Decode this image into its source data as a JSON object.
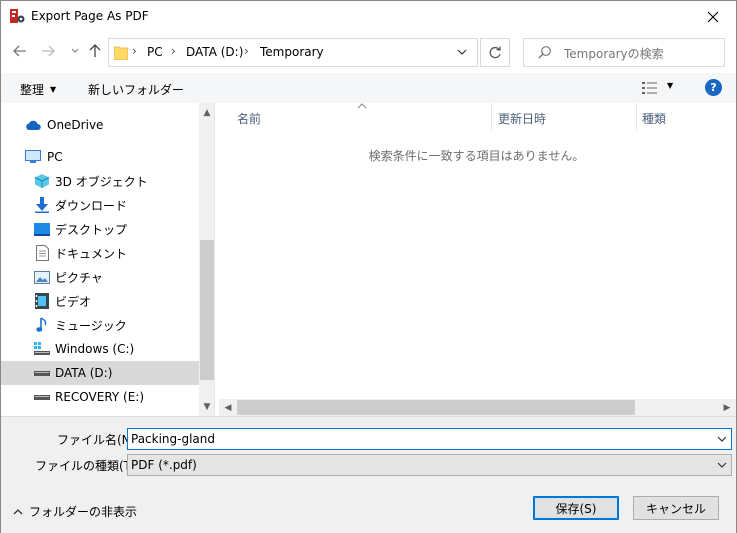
{
  "window": {
    "title": "Export Page As PDF"
  },
  "address": {
    "crumbs": [
      "PC",
      "DATA (D:)",
      "Temporary"
    ],
    "search_placeholder": "Temporaryの検索"
  },
  "toolbar": {
    "organize_label": "整理",
    "new_folder_label": "新しいフォルダー",
    "help_label": "?"
  },
  "nav": {
    "items": [
      {
        "label": "OneDrive",
        "icon": "cloud-icon"
      },
      {
        "label": "PC",
        "icon": "computer-icon"
      },
      {
        "label": "3D オブジェクト",
        "icon": "cube-icon"
      },
      {
        "label": "ダウンロード",
        "icon": "download-icon"
      },
      {
        "label": "デスクトップ",
        "icon": "desktop-icon"
      },
      {
        "label": "ドキュメント",
        "icon": "document-icon"
      },
      {
        "label": "ピクチャ",
        "icon": "picture-icon"
      },
      {
        "label": "ビデオ",
        "icon": "video-icon"
      },
      {
        "label": "ミュージック",
        "icon": "music-icon"
      },
      {
        "label": "Windows (C:)",
        "icon": "drive-icon"
      },
      {
        "label": "DATA (D:)",
        "icon": "drive-icon",
        "selected": true
      },
      {
        "label": "RECOVERY (E:)",
        "icon": "drive-icon"
      }
    ]
  },
  "filelist": {
    "columns": [
      "名前",
      "更新日時",
      "種類"
    ],
    "empty_message": "検索条件に一致する項目はありません。"
  },
  "form": {
    "filename_label": "ファイル名(N):",
    "filename_value": "Packing-gland",
    "filetype_label": "ファイルの種類(T):",
    "filetype_value": "PDF (*.pdf)"
  },
  "footer": {
    "hide_folders_label": "フォルダーの非表示",
    "save_label": "保存(S)",
    "cancel_label": "キャンセル"
  },
  "colors": {
    "accent": "#0078d7",
    "help": "#1a66c4",
    "selected": "#d9d9d9"
  }
}
